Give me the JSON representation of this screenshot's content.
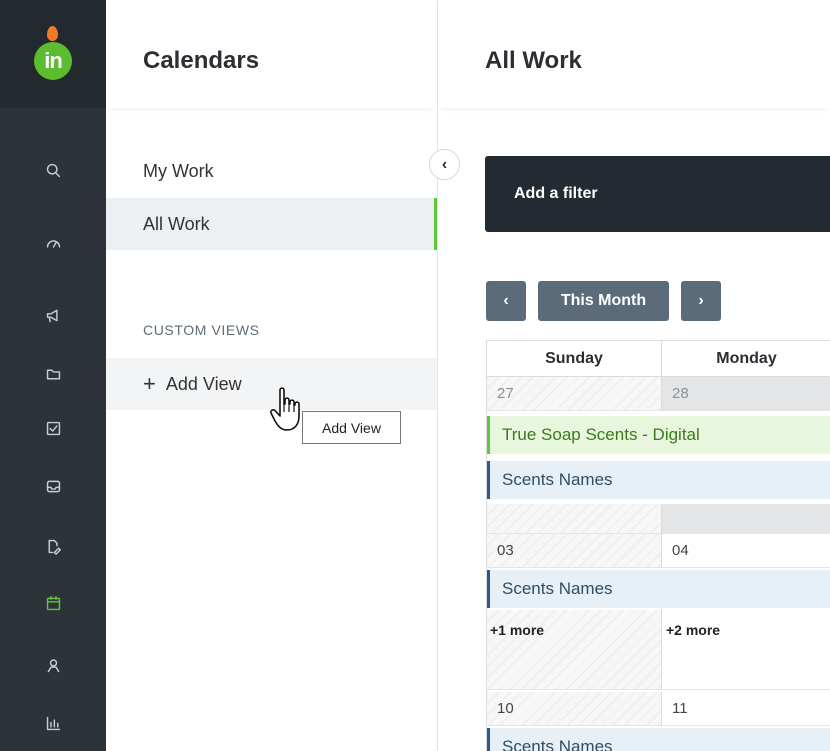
{
  "rail": {
    "logo_text": "in",
    "brand_color": "#5cbc2f",
    "icons": [
      {
        "name": "search-icon",
        "active": false
      },
      {
        "name": "dashboard-icon",
        "active": false
      },
      {
        "name": "megaphone-icon",
        "active": false
      },
      {
        "name": "folder-icon",
        "active": false
      },
      {
        "name": "checkbox-icon",
        "active": false
      },
      {
        "name": "inbox-icon",
        "active": false
      },
      {
        "name": "proof-icon",
        "active": false
      },
      {
        "name": "calendar-icon",
        "active": true
      },
      {
        "name": "person-icon",
        "active": false
      },
      {
        "name": "reports-icon",
        "active": false
      }
    ]
  },
  "panel": {
    "title": "Calendars",
    "items": [
      {
        "label": "My Work",
        "active": false
      },
      {
        "label": "All Work",
        "active": true
      }
    ],
    "custom_views_label": "CUSTOM VIEWS",
    "add_view_label": "Add View",
    "add_view_plus": "+",
    "tooltip": "Add View"
  },
  "main": {
    "title": "All Work",
    "filter_label": "Add a filter",
    "prev_label": "‹",
    "this_month_label": "This Month",
    "next_label": "›",
    "day_headers": [
      "Sunday",
      "Monday"
    ],
    "weeks": [
      {
        "sunday": "27",
        "monday": "28"
      },
      {
        "sunday": "03",
        "monday": "04"
      },
      {
        "sunday": "10",
        "monday": "11"
      }
    ],
    "events": {
      "true_soap": "True Soap Scents - Digital",
      "scents_1": "Scents Names",
      "scents_2": "Scents Names",
      "scents_3": "Scents Names"
    },
    "more": {
      "sunday": "+1 more",
      "monday": "+2 more"
    }
  }
}
